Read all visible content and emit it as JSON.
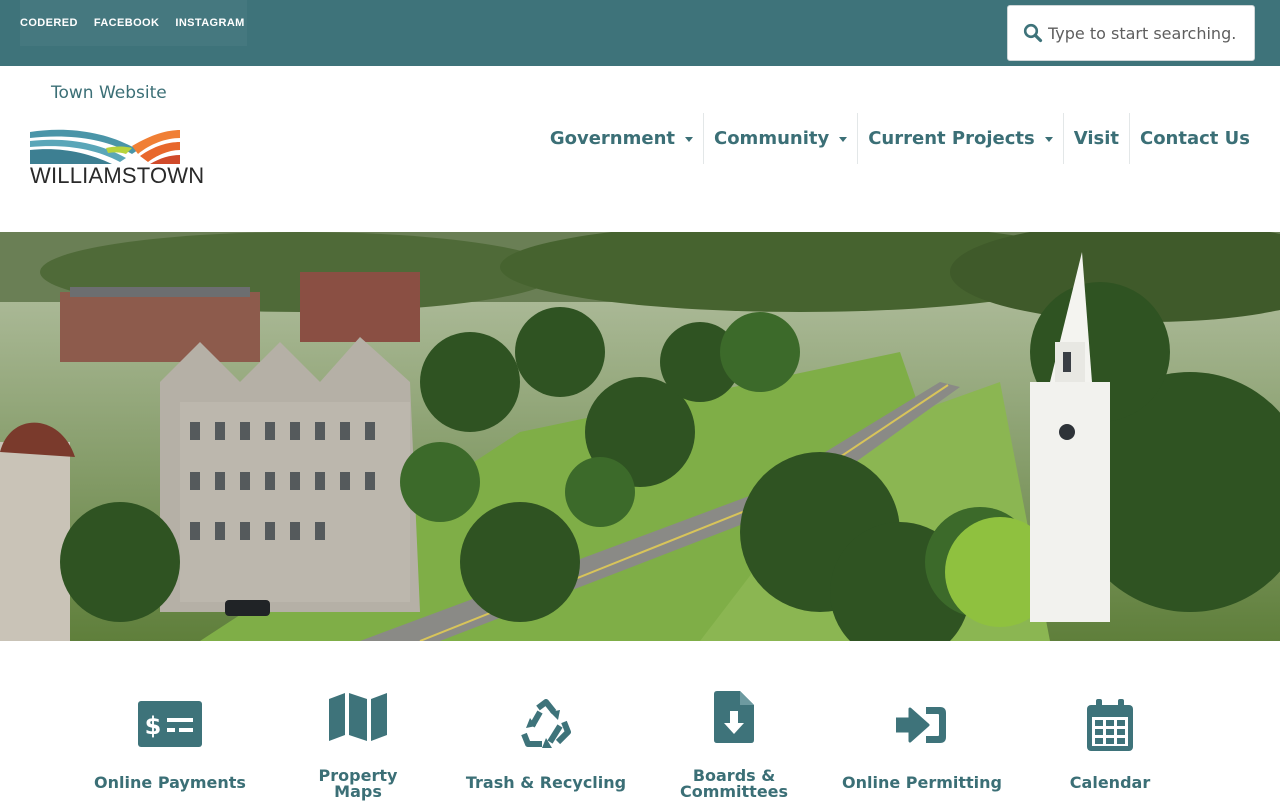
{
  "topbar": {
    "social_links": [
      "CODERED",
      "FACEBOOK",
      "INSTAGRAM"
    ],
    "search_placeholder": "Type to start searching."
  },
  "header": {
    "town_link": "Town Website",
    "logo_text": "WILLIAMSTOWN"
  },
  "nav": {
    "items": [
      {
        "label": "Government",
        "dropdown": true
      },
      {
        "label": "Community",
        "dropdown": true
      },
      {
        "label": "Current Projects",
        "dropdown": true
      },
      {
        "label": "Visit",
        "dropdown": false
      },
      {
        "label": "Contact Us",
        "dropdown": false
      }
    ]
  },
  "quick_links": [
    {
      "label_lines": [
        "Online Payments"
      ],
      "icon": "money-bill-icon"
    },
    {
      "label_lines": [
        "Property",
        "Maps"
      ],
      "icon": "map-icon"
    },
    {
      "label_lines": [
        "Trash & Recycling"
      ],
      "icon": "recycle-icon"
    },
    {
      "label_lines": [
        "Boards &",
        "Committees"
      ],
      "icon": "file-download-icon"
    },
    {
      "label_lines": [
        "Online Permitting"
      ],
      "icon": "sign-in-icon"
    },
    {
      "label_lines": [
        "Calendar"
      ],
      "icon": "calendar-icon"
    }
  ],
  "colors": {
    "teal": "#3e737a",
    "logo_blue": "#2e93b8",
    "logo_lime": "#b7d33c",
    "logo_orange": "#f07f35",
    "logo_red": "#d04a2a"
  }
}
